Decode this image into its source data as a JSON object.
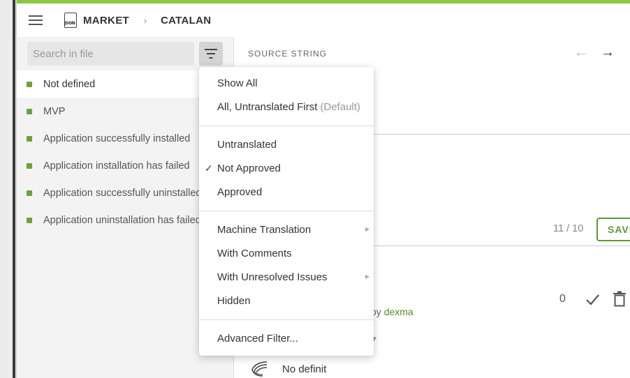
{
  "breadcrumb": {
    "file_icon_tag": "JSON",
    "project": "MARKET",
    "separator": "›",
    "language": "CATALAN"
  },
  "sidebar": {
    "search_placeholder": "Search in file",
    "items": [
      {
        "label": "Not defined",
        "active": true
      },
      {
        "label": "MVP"
      },
      {
        "label": "Application successfully installed"
      },
      {
        "label": "Application installation has failed"
      },
      {
        "label": "Application successfully uninstalled"
      },
      {
        "label": "Application uninstallation has failed"
      }
    ],
    "status_color": "#6aa33a"
  },
  "editor": {
    "source_label": "SOURCE STRING",
    "prev_arrow": "←",
    "next_arrow": "→",
    "counter": "11 / 10",
    "save_label": "SAVE",
    "score": "0",
    "byline_pre": "by",
    "byline_user": "dexma",
    "tm_text": "No definit",
    "accent": "#5b9a33"
  },
  "filter_menu": {
    "groups": [
      [
        {
          "label": "Show All"
        },
        {
          "label": "All, Untranslated First",
          "note": "(Default)"
        }
      ],
      [
        {
          "label": "Untranslated"
        },
        {
          "label": "Not Approved",
          "checked": true,
          "check": "✓"
        },
        {
          "label": "Approved"
        }
      ],
      [
        {
          "label": "Machine Translation",
          "submenu": true
        },
        {
          "label": "With Comments"
        },
        {
          "label": "With Unresolved Issues",
          "submenu": true
        },
        {
          "label": "Hidden"
        }
      ],
      [
        {
          "label": "Advanced Filter..."
        }
      ]
    ]
  },
  "icons": {
    "menu": "hamburger-icon",
    "filter": "filter-icon",
    "approve": "check-icon",
    "delete": "trash-icon",
    "submenu": "chevron-right-icon"
  },
  "theme": {
    "brand_green": "#8dc63f"
  }
}
